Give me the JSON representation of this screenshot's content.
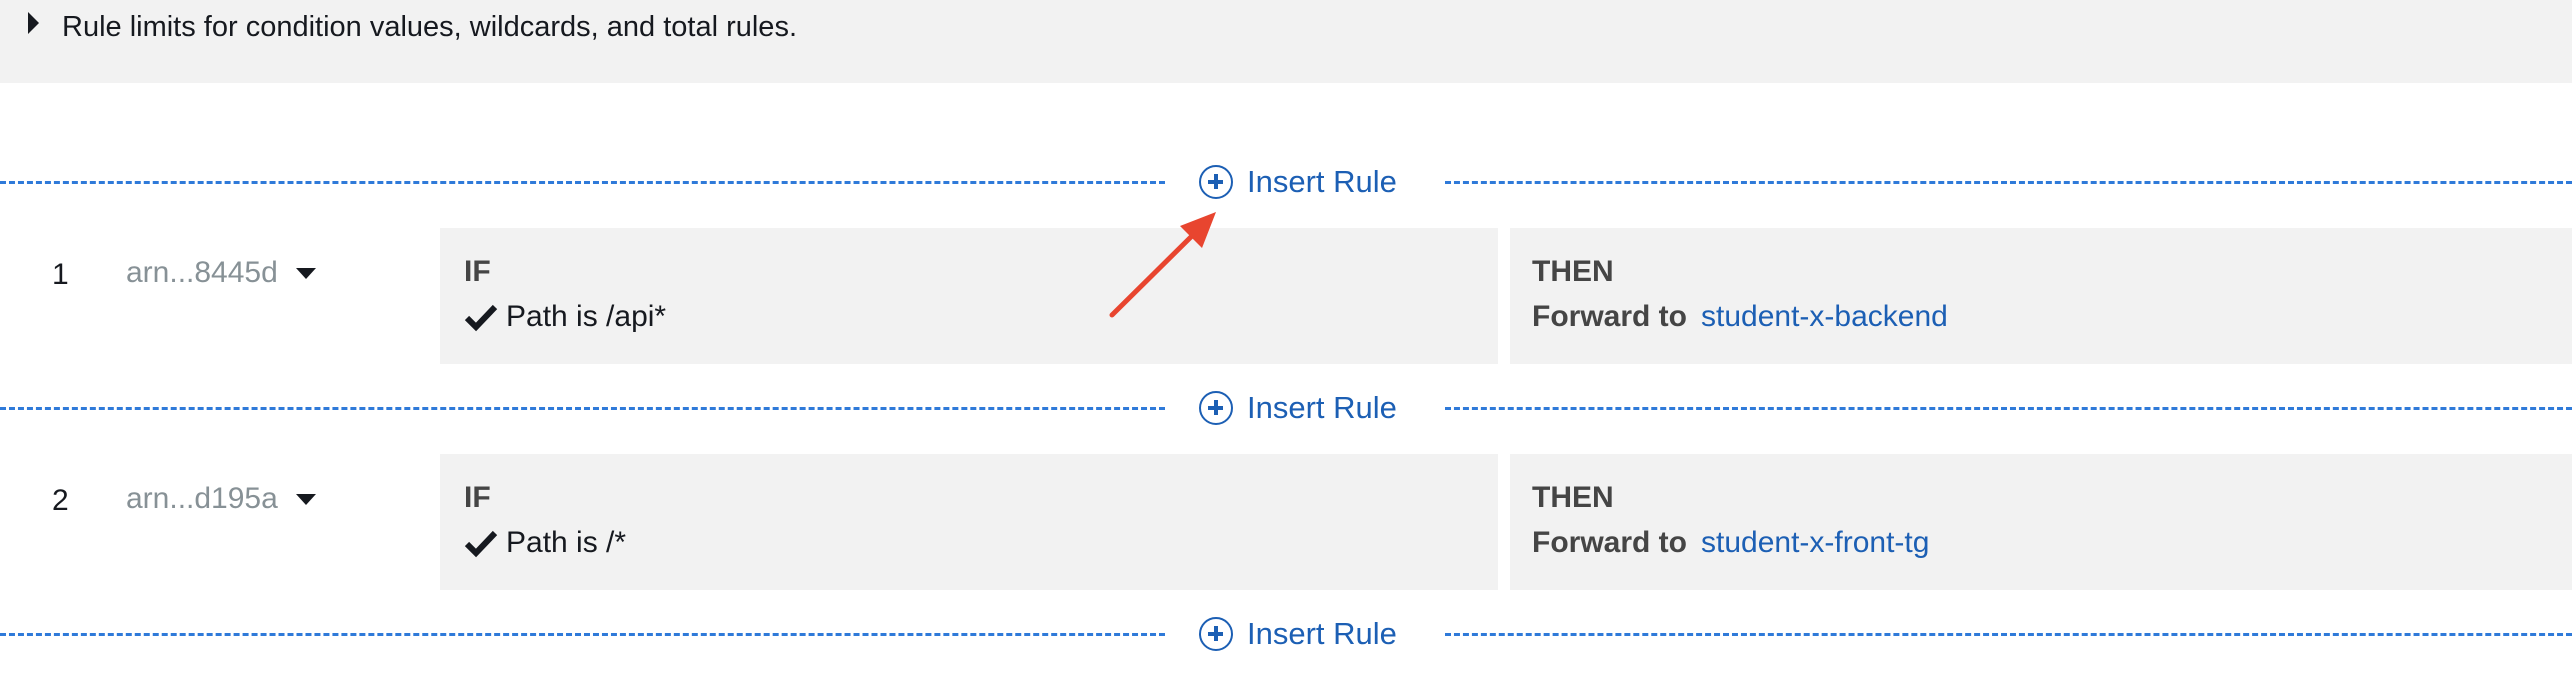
{
  "limits": {
    "text": "Rule limits for condition values, wildcards, and total rules."
  },
  "insert_rule": {
    "label": "Insert Rule"
  },
  "rules": [
    {
      "number": "1",
      "arn": "arn...8445d",
      "if_label": "IF",
      "condition": "Path is /api*",
      "then_label": "THEN",
      "action_label": "Forward to",
      "target": "student-x-backend"
    },
    {
      "number": "2",
      "arn": "arn...d195a",
      "if_label": "IF",
      "condition": "Path is /*",
      "then_label": "THEN",
      "action_label": "Forward to",
      "target": "student-x-front-tg"
    }
  ],
  "colors": {
    "link": "#1c5fb4",
    "dash": "#2f7ad9",
    "panel": "#f2f2f2",
    "annotation_arrow": "#e8452f"
  },
  "icons": [
    "caret-right-icon",
    "plus-circle-icon",
    "caret-down-icon",
    "checkmark-icon",
    "annotation-arrow"
  ]
}
